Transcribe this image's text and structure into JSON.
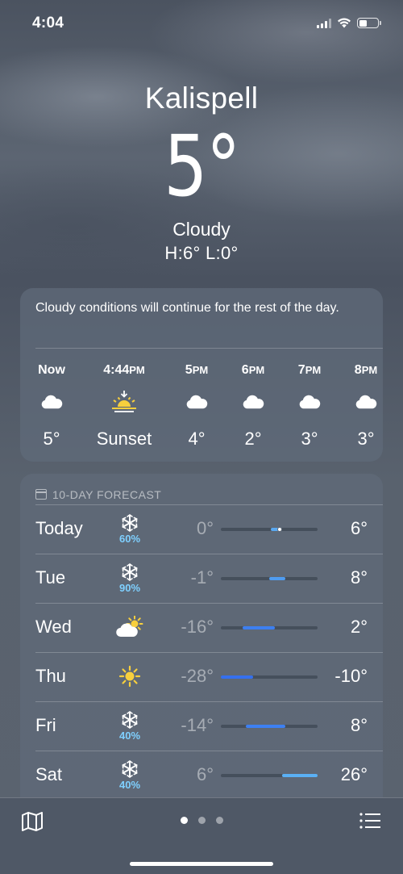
{
  "status_bar": {
    "time": "4:04"
  },
  "location": {
    "city": "Kalispell",
    "temperature": "5°",
    "condition": "Cloudy",
    "high_low": "H:6°  L:0°"
  },
  "hourly": {
    "summary": "Cloudy conditions will continue for the rest of the day.",
    "items": [
      {
        "time": "Now",
        "suffix": "",
        "icon": "cloud-icon",
        "value": "5°"
      },
      {
        "time": "4:44",
        "suffix": "PM",
        "icon": "sunset-icon",
        "value": "Sunset"
      },
      {
        "time": "5",
        "suffix": "PM",
        "icon": "cloud-icon",
        "value": "4°"
      },
      {
        "time": "6",
        "suffix": "PM",
        "icon": "cloud-icon",
        "value": "2°"
      },
      {
        "time": "7",
        "suffix": "PM",
        "icon": "cloud-icon",
        "value": "3°"
      },
      {
        "time": "8",
        "suffix": "PM",
        "icon": "cloud-icon",
        "value": "3°"
      }
    ]
  },
  "forecast": {
    "title": "10-DAY FORECAST",
    "range_min": -28,
    "range_max": 26,
    "days": [
      {
        "day": "Today",
        "icon": "snowflake-icon",
        "precip": "60%",
        "low": "0°",
        "high": "6°",
        "low_value": 0,
        "high_value": 6,
        "current_value": 5,
        "color": "#5aa8f0"
      },
      {
        "day": "Tue",
        "icon": "snowflake-icon",
        "precip": "90%",
        "low": "-1°",
        "high": "8°",
        "low_value": -1,
        "high_value": 8,
        "color": "#4f9cf0"
      },
      {
        "day": "Wed",
        "icon": "partly-sunny-icon",
        "precip": "",
        "low": "-16°",
        "high": "2°",
        "low_value": -16,
        "high_value": 2,
        "color": "#3d7ff0"
      },
      {
        "day": "Thu",
        "icon": "sun-icon",
        "precip": "",
        "low": "-28°",
        "high": "-10°",
        "low_value": -28,
        "high_value": -10,
        "color": "#3570ee"
      },
      {
        "day": "Fri",
        "icon": "snowflake-icon",
        "precip": "40%",
        "low": "-14°",
        "high": "8°",
        "low_value": -14,
        "high_value": 8,
        "color": "#3d80f2"
      },
      {
        "day": "Sat",
        "icon": "snowflake-icon",
        "precip": "40%",
        "low": "6°",
        "high": "26°",
        "low_value": 6,
        "high_value": 26,
        "color": "#5ab0f5"
      }
    ]
  },
  "bottom_bar": {
    "page_count": 3,
    "active_page": 1
  },
  "colors": {
    "precip": "#7fd0ff",
    "sun": "#f7cf3d"
  }
}
